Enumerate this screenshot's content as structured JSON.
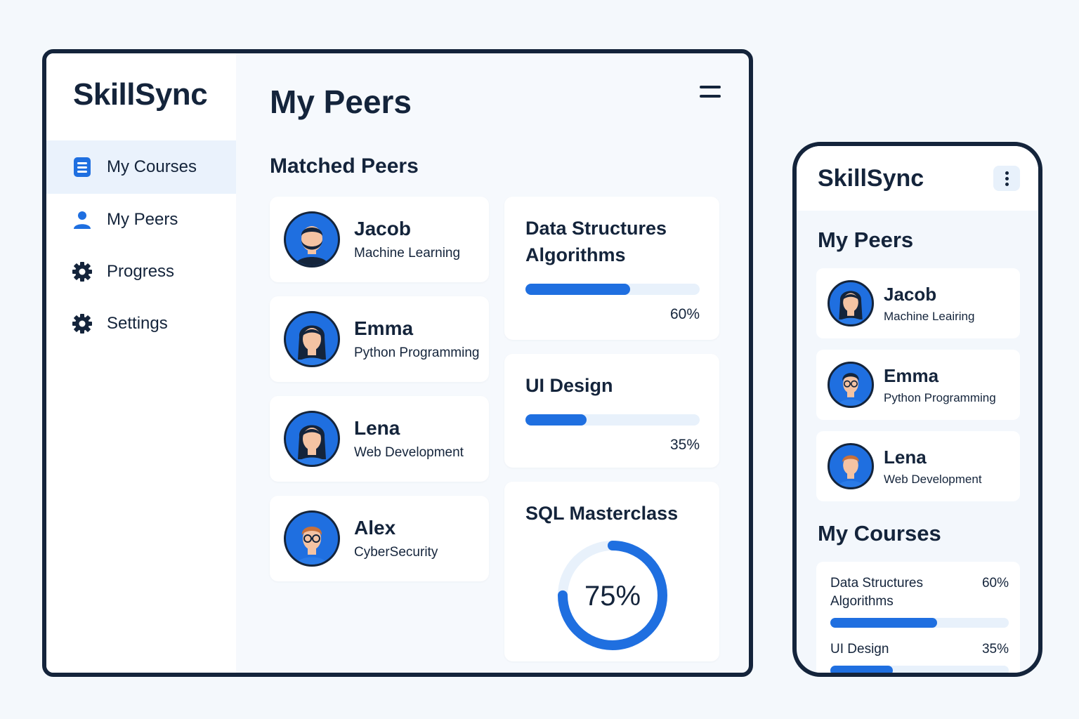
{
  "colors": {
    "accent": "#1f6fe0",
    "ink": "#14243b",
    "track": "#e8f1fb"
  },
  "desktop": {
    "logo": "SkillSync",
    "nav": [
      {
        "label": "My Courses",
        "icon": "list-icon"
      },
      {
        "label": "My Peers",
        "icon": "user-icon"
      },
      {
        "label": "Progress",
        "icon": "gear-icon"
      },
      {
        "label": "Settings",
        "icon": "gear-icon"
      }
    ],
    "page_title": "My Peers",
    "section_title": "Matched Peers",
    "peers": [
      {
        "name": "Jacob",
        "topic": "Machine Learning"
      },
      {
        "name": "Emma",
        "topic": "Python Programming"
      },
      {
        "name": "Lena",
        "topic": "Web Development"
      },
      {
        "name": "Alex",
        "topic": "CyberSecurity"
      }
    ],
    "courses": [
      {
        "name_line1": "Data Structures",
        "name_line2": "Algorithms",
        "progress": 0.6,
        "label": "60%"
      },
      {
        "name_line1": "UI Design",
        "name_line2": "",
        "progress": 0.35,
        "label": "35%"
      },
      {
        "name_line1": "SQL Masterclass",
        "progress": 0.75,
        "label": "75%"
      }
    ]
  },
  "mobile": {
    "logo": "SkillSync",
    "title": "My Peers",
    "peers": [
      {
        "name": "Jacob",
        "topic": "Machine Leairing"
      },
      {
        "name": "Emma",
        "topic": "Python Programming"
      },
      {
        "name": "Lena",
        "topic": "Web Development"
      }
    ],
    "courses_title": "My Courses",
    "courses": [
      {
        "name_line1": "Data Structures",
        "name_line2": "Algorithms",
        "progress": 0.6,
        "label": "60%"
      },
      {
        "name_line1": "UI Design",
        "name_line2": "",
        "progress": 0.35,
        "label": "35%"
      }
    ]
  }
}
